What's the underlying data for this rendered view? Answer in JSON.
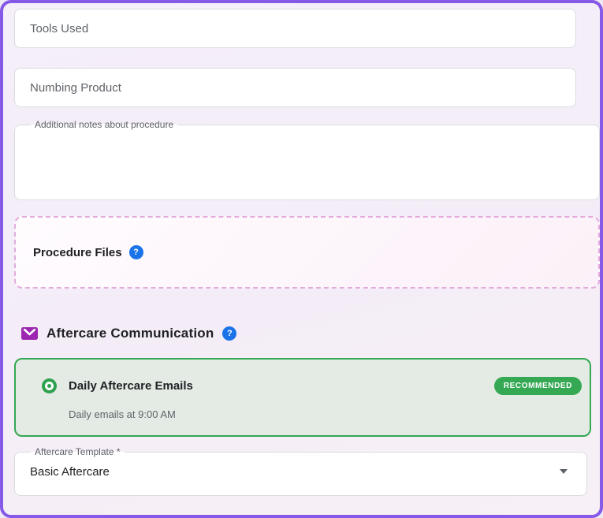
{
  "form": {
    "tools_used": {
      "placeholder": "Tools Used",
      "value": ""
    },
    "numbing_product": {
      "placeholder": "Numbing Product",
      "value": ""
    },
    "notes": {
      "label": "Additional notes about procedure",
      "value": ""
    },
    "procedure_files": {
      "title": "Procedure Files"
    }
  },
  "aftercare": {
    "section_title": "Aftercare Communication",
    "option": {
      "title": "Daily Aftercare Emails",
      "subtitle": "Daily emails at 9:00 AM",
      "badge": "RECOMMENDED",
      "selected": true
    },
    "template_select": {
      "label": "Aftercare Template *",
      "value": "Basic Aftercare"
    }
  },
  "icons": {
    "help_glyph": "?"
  },
  "colors": {
    "frame_border": "#8659e8",
    "accent_green": "#34a853",
    "accent_blue": "#1a73e8",
    "accent_purple": "#9c27b0",
    "dashed_border": "#e2abdc"
  }
}
